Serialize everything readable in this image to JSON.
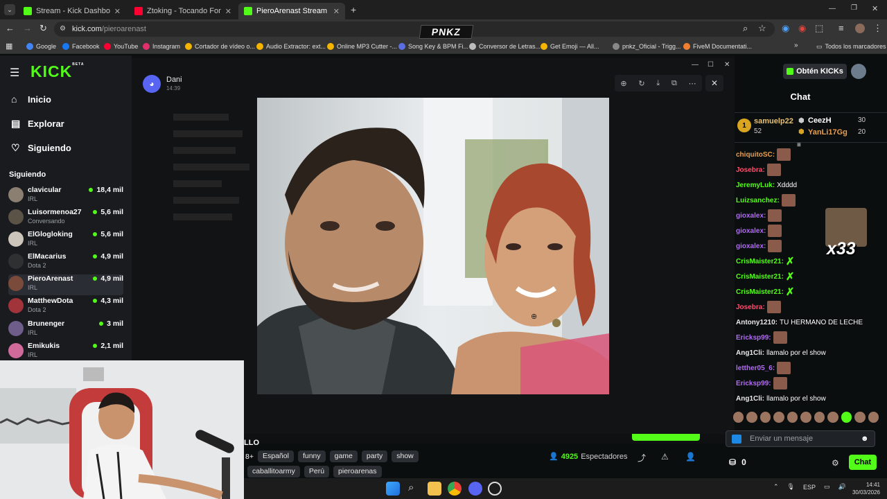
{
  "browser": {
    "tabs": [
      {
        "title": "Stream - Kick Dashboard",
        "color": "#53fc18"
      },
      {
        "title": "Ztoking - Tocando Fondo [Offici",
        "color": "#ff0033"
      },
      {
        "title": "PieroArenast Stream - Watch Li",
        "color": "#53fc18"
      }
    ],
    "url_host": "kick.com",
    "url_path": "/pieroarenast",
    "bookmarks": [
      {
        "label": "Google",
        "color": "#4285f4"
      },
      {
        "label": "Facebook",
        "color": "#1877f2"
      },
      {
        "label": "YouTube",
        "color": "#ff0033"
      },
      {
        "label": "Instagram",
        "color": "#e1306c"
      },
      {
        "label": "Cortador de vídeo o...",
        "color": "#f4b400"
      },
      {
        "label": "Audio Extractor: ext...",
        "color": "#f4b400"
      },
      {
        "label": "Online MP3 Cutter -...",
        "color": "#f4b400"
      },
      {
        "label": "Song Key & BPM Fi...",
        "color": "#5b6ee1"
      },
      {
        "label": "Conversor de Letras...",
        "color": "#bbbbbb"
      },
      {
        "label": "Get Emoji — All...",
        "color": "#f4b400"
      },
      {
        "label": "pnkz_Oficial - Trigg...",
        "color": "#888888"
      },
      {
        "label": "FiveM Documentati...",
        "color": "#f08030"
      }
    ],
    "bookmarks_all": "Todos los marcadores",
    "overlay_logo": "PNKZ"
  },
  "sidebar": {
    "logo": "KICK",
    "logo_sup": "BETA",
    "nav": [
      {
        "label": "Inicio",
        "icon": "home-icon"
      },
      {
        "label": "Explorar",
        "icon": "browse-icon"
      },
      {
        "label": "Siguiendo",
        "icon": "heart-icon"
      }
    ],
    "following_header": "Siguiendo",
    "channels": [
      {
        "name": "clavicular",
        "category": "IRL",
        "viewers": "18,4 mil",
        "color": "#8a7f70"
      },
      {
        "name": "Luisormenoa27",
        "category": "Conversando",
        "viewers": "5,6 mil",
        "color": "#5c5347"
      },
      {
        "name": "ElGlogloking",
        "category": "IRL",
        "viewers": "5,6 mil",
        "color": "#ccc5bb"
      },
      {
        "name": "ElMacarius",
        "category": "Dota 2",
        "viewers": "4,9 mil",
        "color": "#2f3032"
      },
      {
        "name": "PieroArenast",
        "category": "IRL",
        "viewers": "4,9 mil",
        "color": "#7a4a3a"
      },
      {
        "name": "MatthewDota",
        "category": "Dota 2",
        "viewers": "4,3 mil",
        "color": "#a0343a"
      },
      {
        "name": "Brunenger",
        "category": "IRL",
        "viewers": "3 mil",
        "color": "#6e5c8a"
      },
      {
        "name": "Emikukis",
        "category": "IRL",
        "viewers": "2,1 mil",
        "color": "#d06a9a"
      }
    ]
  },
  "discord": {
    "user": "Dani",
    "time": "14:39"
  },
  "stream": {
    "title_fragment": "LLO",
    "tags_prefix": "8+",
    "tags": [
      "Español",
      "funny",
      "game",
      "party",
      "show"
    ],
    "tags2": [
      "caballitoarmy",
      "Perú",
      "pieroarenas"
    ],
    "viewers": "4925",
    "viewers_label": "Espectadores"
  },
  "chat": {
    "kicks_button": "Obtén KICKs",
    "header": "Chat",
    "leader": [
      {
        "name": "samuelp22",
        "amount": "52"
      },
      {
        "name": "CeezH",
        "amount": "30"
      },
      {
        "name": "YanLi17Gg",
        "amount": "20"
      }
    ],
    "big_emote_count": "x33",
    "messages": [
      {
        "user": "chiquitoSC:",
        "color": "#e8a050",
        "text": "",
        "emote": "face"
      },
      {
        "user": "Josebra:",
        "color": "#ff4d6d",
        "text": "",
        "emote": "face"
      },
      {
        "user": "JeremyLuk:",
        "color": "#53fc18",
        "text": "Xdddd",
        "emote": ""
      },
      {
        "user": "Luizsanchez:",
        "color": "#53fc18",
        "text": "",
        "emote": "face"
      },
      {
        "user": "gioxalex:",
        "color": "#b06cf0",
        "text": "",
        "emote": "face"
      },
      {
        "user": "gioxalex:",
        "color": "#b06cf0",
        "text": "",
        "emote": "face"
      },
      {
        "user": "gioxalex:",
        "color": "#b06cf0",
        "text": "",
        "emote": "face"
      },
      {
        "user": "CrisMaister21:",
        "color": "#53fc18",
        "text": "",
        "emote": "green"
      },
      {
        "user": "CrisMaister21:",
        "color": "#53fc18",
        "text": "",
        "emote": "green"
      },
      {
        "user": "CrisMaister21:",
        "color": "#53fc18",
        "text": "",
        "emote": "green"
      },
      {
        "user": "Josebra:",
        "color": "#ff4d6d",
        "text": "",
        "emote": "face"
      },
      {
        "user": "Antony1210:",
        "color": "#e8e8e8",
        "text": "TU HERMANO DE LECHE",
        "emote": ""
      },
      {
        "user": "Ericksp99:",
        "color": "#b06cf0",
        "text": "",
        "emote": "face"
      },
      {
        "user": "Ang1Cli:",
        "color": "#e8e8e8",
        "text": "llamalo por el show",
        "emote": ""
      },
      {
        "user": "letther05_6:",
        "color": "#b06cf0",
        "text": "",
        "emote": "face"
      },
      {
        "user": "Ericksp99:",
        "color": "#b06cf0",
        "text": "",
        "emote": "face"
      },
      {
        "user": "Ang1Cli:",
        "color": "#e8e8e8",
        "text": "llamalo por el show",
        "emote": ""
      }
    ],
    "input_placeholder": "Enviar un mensaje",
    "points": "0",
    "send_label": "Chat"
  },
  "taskbar": {
    "lang": "ESP",
    "time": "14:41",
    "date": "30/03/2026"
  },
  "colors": {
    "kick_green": "#53fc18",
    "panel": "#191b1f",
    "discord_blurple": "#5865f2"
  }
}
